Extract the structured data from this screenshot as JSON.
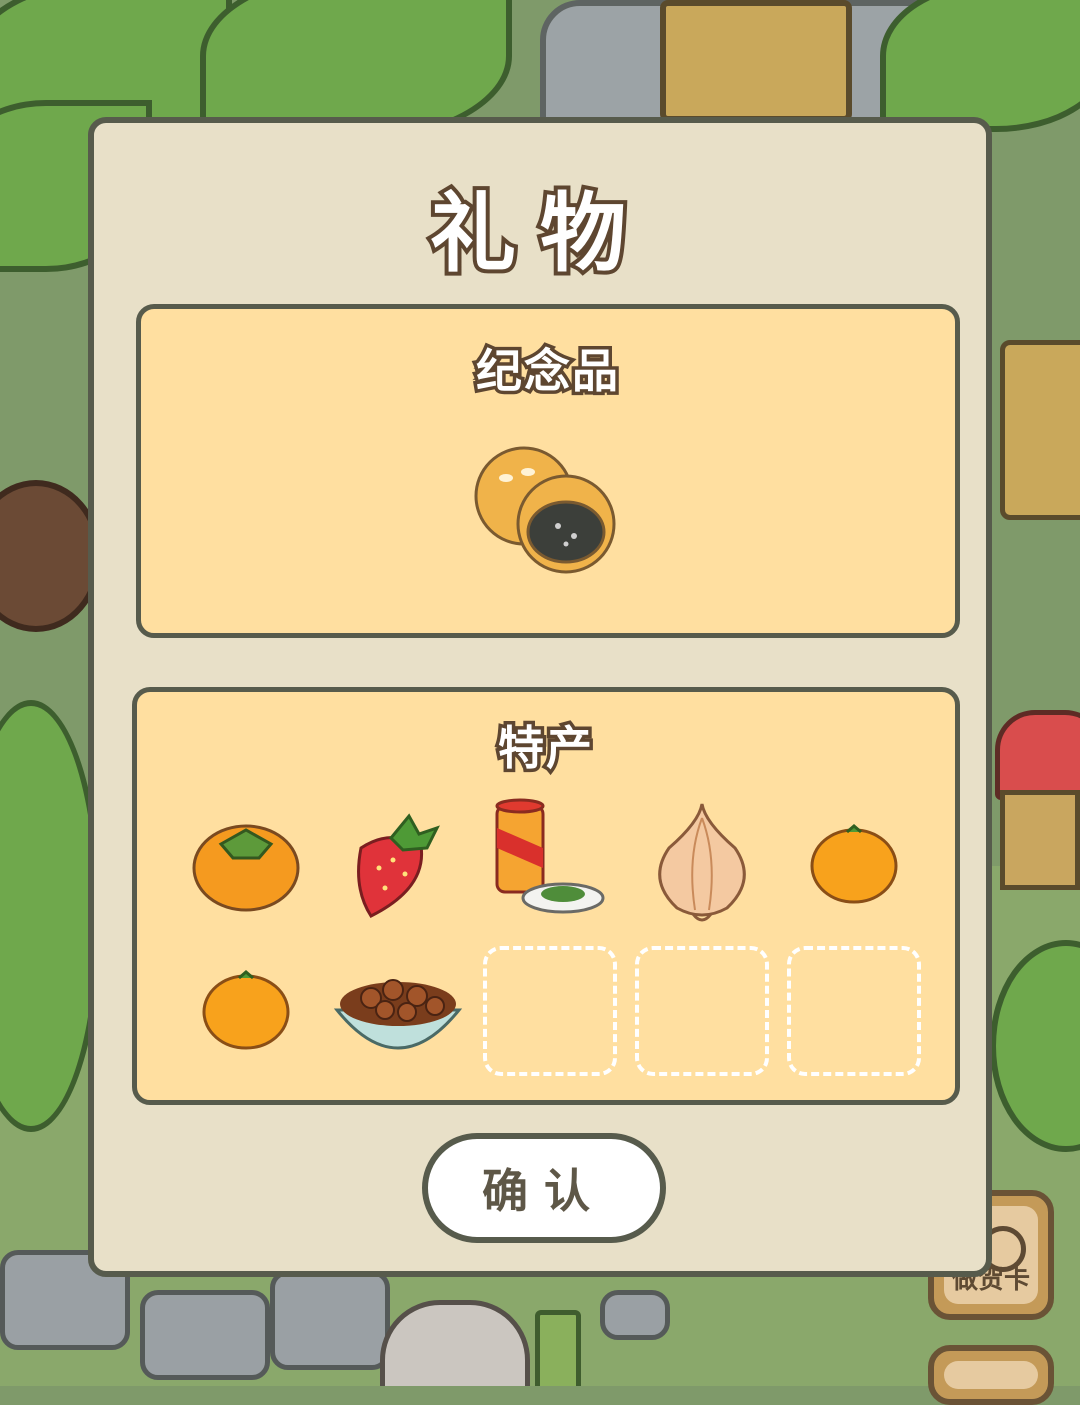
{
  "dialog": {
    "title": "礼物",
    "souvenir_section": {
      "title": "纪念品",
      "items": [
        {
          "name": "mooncake-pastry-icon"
        }
      ]
    },
    "specialty_section": {
      "title": "特产",
      "items": [
        {
          "name": "persimmon-icon",
          "filled": true
        },
        {
          "name": "strawberry-icon",
          "filled": true
        },
        {
          "name": "tea-can-icon",
          "filled": true
        },
        {
          "name": "onion-icon",
          "filled": true
        },
        {
          "name": "mandarin-orange-icon",
          "filled": true
        },
        {
          "name": "mandarin-orange-icon",
          "filled": true
        },
        {
          "name": "roasted-chestnuts-bowl-icon",
          "filled": true
        },
        {
          "name": "empty-slot",
          "filled": false
        },
        {
          "name": "empty-slot",
          "filled": false
        },
        {
          "name": "empty-slot",
          "filled": false
        }
      ]
    },
    "confirm_label": "确认"
  },
  "side_buttons": {
    "card_label": "做贺卡"
  },
  "colors": {
    "dialog_bg": "#e8e0c8",
    "panel_bg": "#ffdfa0",
    "border": "#575b4c",
    "title_outline": "#5e4630"
  }
}
